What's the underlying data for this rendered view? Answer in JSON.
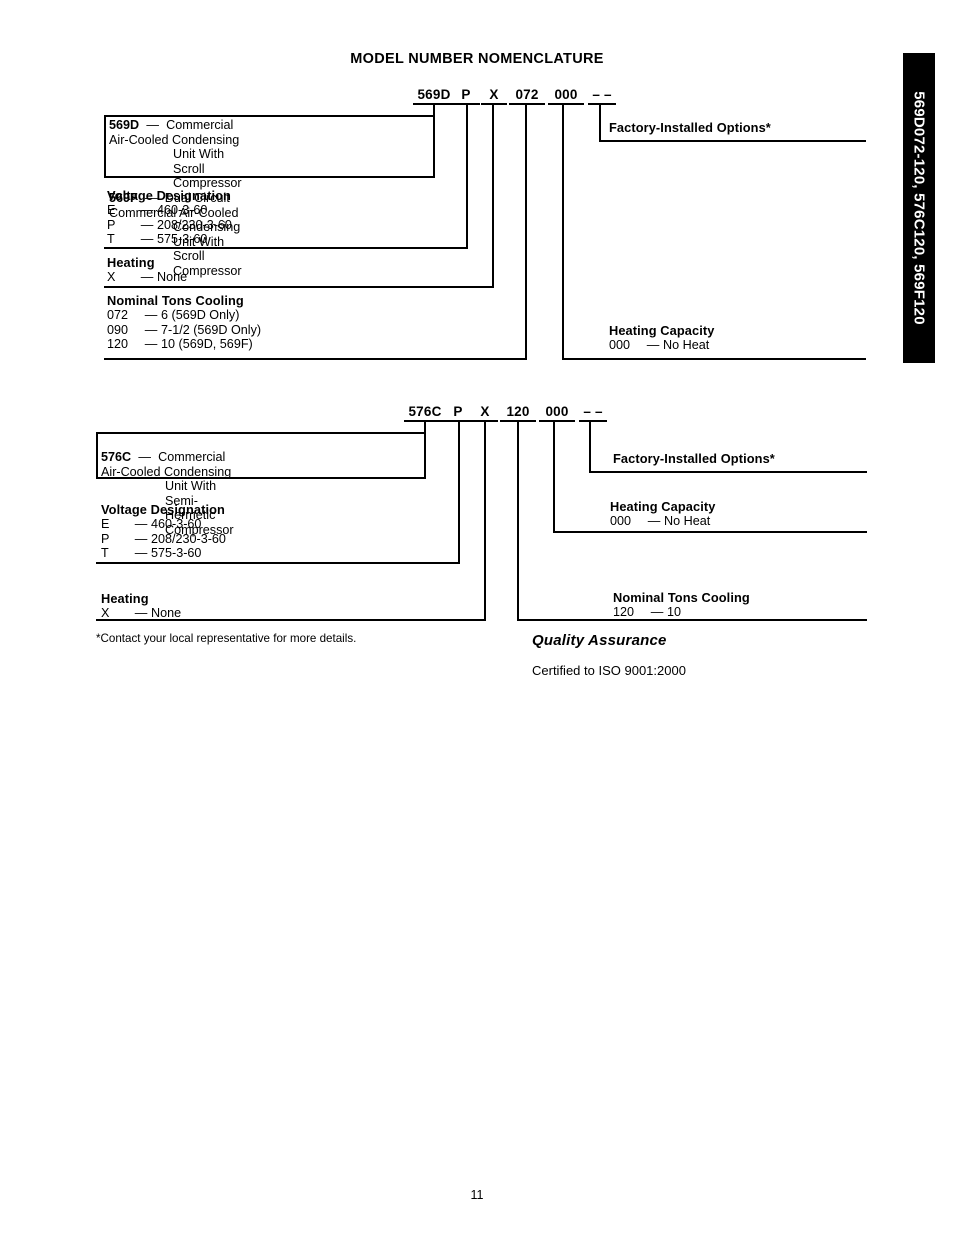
{
  "page": {
    "title": "MODEL NUMBER NOMENCLATURE",
    "number": "11",
    "side_tab": "569D072-120, 576C120, 569F120",
    "footnote": "*Contact your local representative for more details."
  },
  "quality_assurance": {
    "title": "Quality Assurance",
    "text": "Certified to ISO 9001:2000"
  },
  "diagram1": {
    "code_segments": [
      "569D",
      "P",
      "X",
      "072",
      "000",
      "– –"
    ],
    "model_codes": {
      "title_569d": "569D",
      "dash": "—",
      "desc_569d_line1": "Commercial Air-Cooled Condensing",
      "desc_569d_line2": "Unit With Scroll Compressor",
      "title_569f": "569F",
      "desc_569f_line1": "Dual Circuit Commercial Air-Cooled",
      "desc_569f_line2": "Condensing Unit With Scroll Compressor"
    },
    "voltage": {
      "title": "Voltage Designation",
      "rows": [
        {
          "code": "E",
          "dash": "—",
          "value": "460-3-60"
        },
        {
          "code": "P",
          "dash": "—",
          "value": "208/230-3-60"
        },
        {
          "code": "T",
          "dash": "—",
          "value": "575-3-60"
        }
      ]
    },
    "heating": {
      "title": "Heating",
      "rows": [
        {
          "code": "X",
          "dash": "—",
          "value": "None"
        }
      ]
    },
    "tons": {
      "title": "Nominal Tons Cooling",
      "rows": [
        {
          "code": "072",
          "dash": "—",
          "value": "6 (569D Only)"
        },
        {
          "code": "090",
          "dash": "—",
          "value": "7-1/2 (569D Only)"
        },
        {
          "code": "120",
          "dash": "—",
          "value": "10 (569D, 569F)"
        }
      ]
    },
    "heating_capacity": {
      "title": "Heating Capacity",
      "rows": [
        {
          "code": "000",
          "dash": "—",
          "value": "No Heat"
        }
      ]
    },
    "factory_options": {
      "title": "Factory-Installed Options*"
    }
  },
  "diagram2": {
    "code_segments": [
      "576C",
      "P",
      "X",
      "120",
      "000",
      "– –"
    ],
    "model_codes": {
      "title_576c": "576C",
      "dash": "—",
      "desc_576c_line1": "Commercial Air-Cooled Condensing",
      "desc_576c_line2": "Unit With Semi-Hermetic Compressor"
    },
    "voltage": {
      "title": "Voltage Designation",
      "rows": [
        {
          "code": "E",
          "dash": "—",
          "value": "460-3-60"
        },
        {
          "code": "P",
          "dash": "—",
          "value": "208/230-3-60"
        },
        {
          "code": "T",
          "dash": "—",
          "value": "575-3-60"
        }
      ]
    },
    "heating": {
      "title": "Heating",
      "rows": [
        {
          "code": "X",
          "dash": "—",
          "value": "None"
        }
      ]
    },
    "tons": {
      "title": "Nominal Tons Cooling",
      "rows": [
        {
          "code": "120",
          "dash": "—",
          "value": "10"
        }
      ]
    },
    "heating_capacity": {
      "title": "Heating Capacity",
      "rows": [
        {
          "code": "000",
          "dash": "—",
          "value": "No Heat"
        }
      ]
    },
    "factory_options": {
      "title": "Factory-Installed Options*"
    }
  }
}
